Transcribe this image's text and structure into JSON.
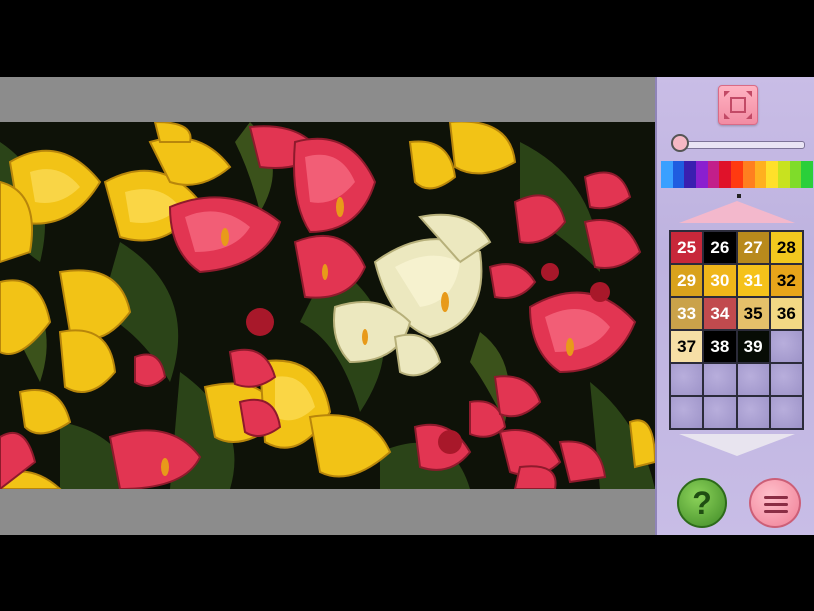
{
  "screen": {
    "name": "paint-by-number"
  },
  "palette": {
    "spectrum_colors": [
      "#3aa0ff",
      "#1f5de0",
      "#3a1fb0",
      "#8a1fcf",
      "#c21f8a",
      "#e0122a",
      "#ff3a10",
      "#ff7f1f",
      "#ffb01f",
      "#ffe02a",
      "#c8e21f",
      "#7fdc2a",
      "#2acf3a"
    ],
    "cells": [
      {
        "num": "25",
        "bg": "#c8283a",
        "fg": "#ffffff"
      },
      {
        "num": "26",
        "bg": "#000000",
        "fg": "#ffffff"
      },
      {
        "num": "27",
        "bg": "#b88a1c",
        "fg": "#ffffff"
      },
      {
        "num": "28",
        "bg": "#f2c81e",
        "fg": "#000000"
      },
      {
        "num": "29",
        "bg": "#d9a21c",
        "fg": "#ffffff"
      },
      {
        "num": "30",
        "bg": "#f0b61a",
        "fg": "#ffffff"
      },
      {
        "num": "31",
        "bg": "#f5c21a",
        "fg": "#ffffff"
      },
      {
        "num": "32",
        "bg": "#e8a51a",
        "fg": "#000000"
      },
      {
        "num": "33",
        "bg": "#caa24a",
        "fg": "#ffffff"
      },
      {
        "num": "34",
        "bg": "#c14a4e",
        "fg": "#ffffff"
      },
      {
        "num": "35",
        "bg": "#e5c06a",
        "fg": "#000000"
      },
      {
        "num": "36",
        "bg": "#f3d884",
        "fg": "#000000"
      },
      {
        "num": "37",
        "bg": "#f6dfa6",
        "fg": "#000000"
      },
      {
        "num": "38",
        "bg": "#000000",
        "fg": "#ffffff"
      },
      {
        "num": "39",
        "bg": "#070c05",
        "fg": "#ffffff"
      }
    ],
    "empty_cells": 9
  },
  "slider": {
    "value": 0
  },
  "buttons": {
    "help_label": "?"
  }
}
